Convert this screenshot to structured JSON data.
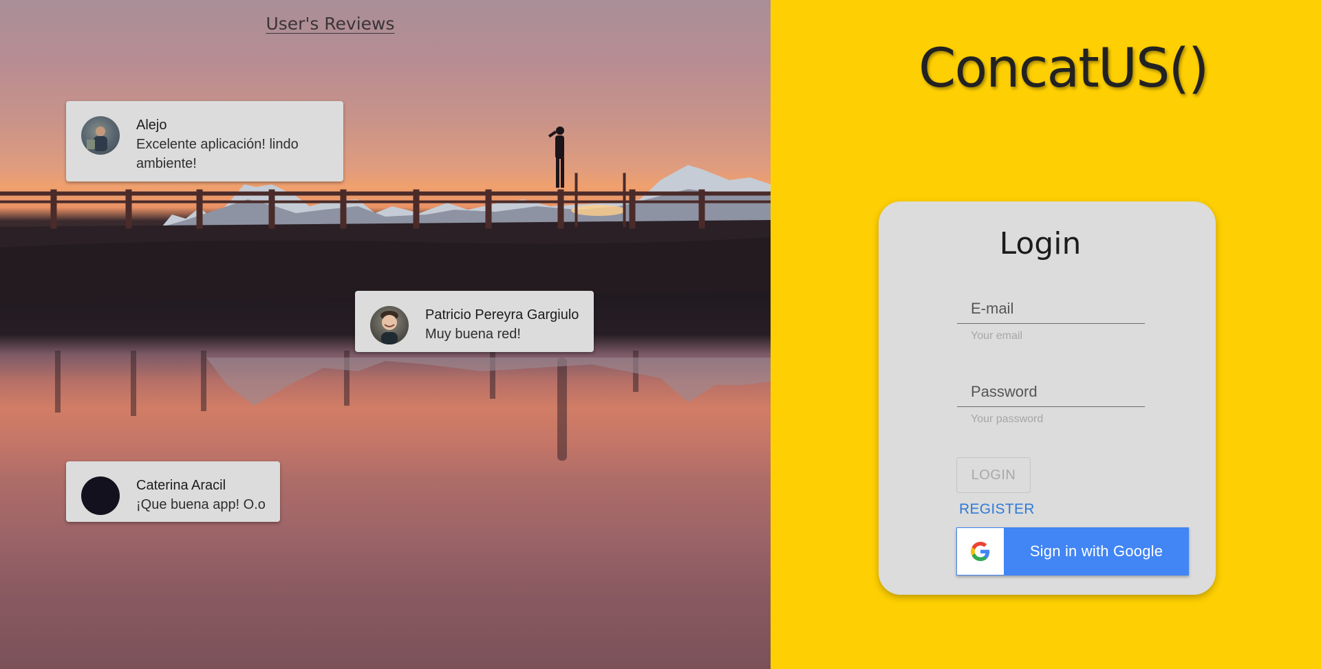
{
  "reviews": {
    "title": "User's Reviews",
    "items": [
      {
        "name": "Alejo",
        "comment": "Excelente aplicación! lindo ambiente!"
      },
      {
        "name": "Patricio Pereyra Gargiulo",
        "comment": "Muy buena red!"
      },
      {
        "name": "Caterina Aracil",
        "comment": "¡Que buena app! O.o"
      }
    ]
  },
  "brand": {
    "logo": "ConcatUS()"
  },
  "login": {
    "title": "Login",
    "email": {
      "placeholder": "E-mail",
      "value": "",
      "helper": "Your email"
    },
    "password": {
      "placeholder": "Password",
      "value": "",
      "helper": "Your password"
    },
    "login_button": "LOGIN",
    "register_link": "REGISTER",
    "google_button": "Sign in with Google"
  },
  "icons": {
    "google": "google-g-icon"
  },
  "colors": {
    "accent_yellow": "#fecf02",
    "google_blue": "#4285f4",
    "register_blue": "#2f7ad6",
    "card_gray": "#dcdcdc"
  }
}
